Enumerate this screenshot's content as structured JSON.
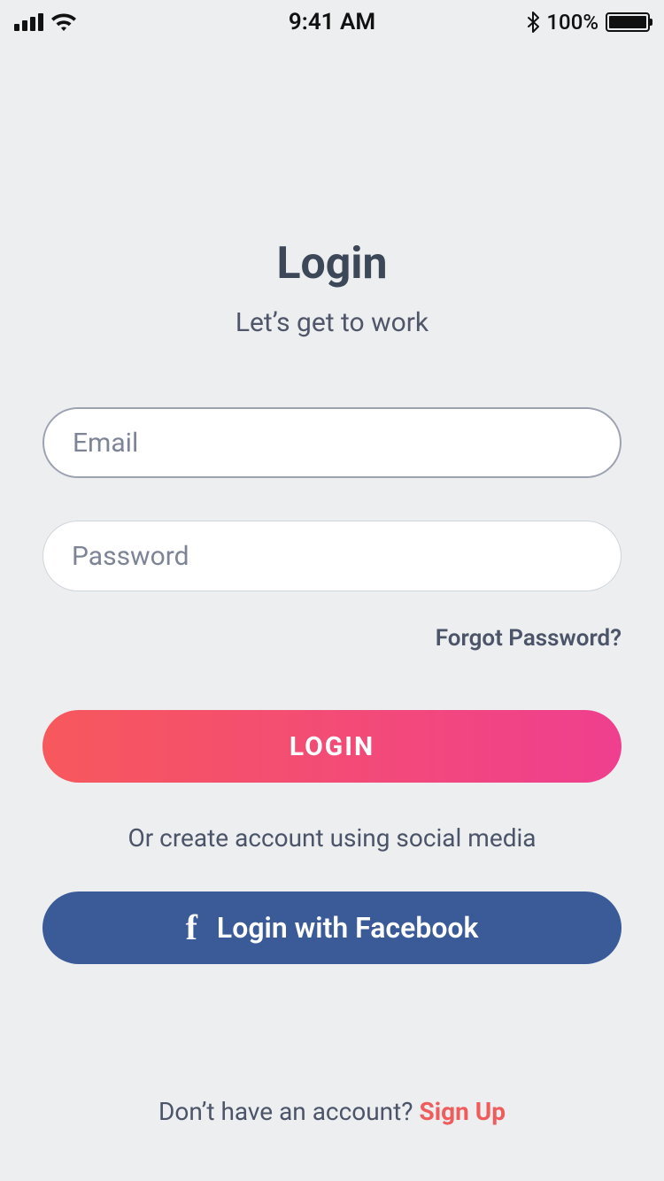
{
  "status_bar": {
    "time": "9:41 AM",
    "battery_pct": "100%"
  },
  "header": {
    "title": "Login",
    "subtitle": "Let’s get to work"
  },
  "form": {
    "email_placeholder": "Email",
    "password_placeholder": "Password",
    "forgot_label": "Forgot Password?"
  },
  "actions": {
    "login_label": "LOGIN",
    "or_text": "Or create account using social media",
    "facebook_label": "Login with Facebook"
  },
  "footer": {
    "prompt": "Don’t have an account? ",
    "signup_label": "Sign Up"
  },
  "icons": {
    "facebook_glyph": "f"
  }
}
